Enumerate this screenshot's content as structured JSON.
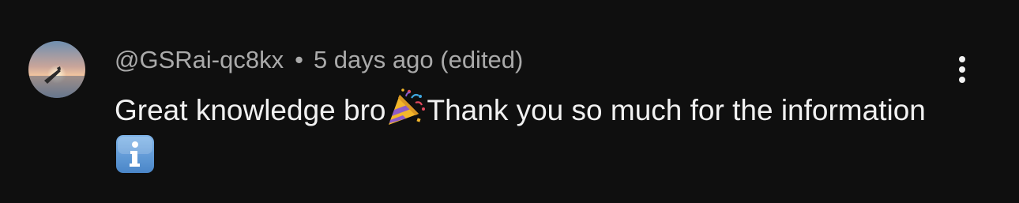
{
  "comment": {
    "author": "@GSRai-qc8kx",
    "separator": "•",
    "time": "5 days ago",
    "edited": "(edited)",
    "text_part1": "Great knowledge bro",
    "emoji1": "party-popper",
    "text_part2": "Thank you so much for the information ",
    "emoji2": "information-source",
    "menu_icon": "more-vertical-icon"
  },
  "colors": {
    "background": "#0f0f0f",
    "meta_text": "#aaaaaa",
    "body_text": "#f1f1f1"
  }
}
